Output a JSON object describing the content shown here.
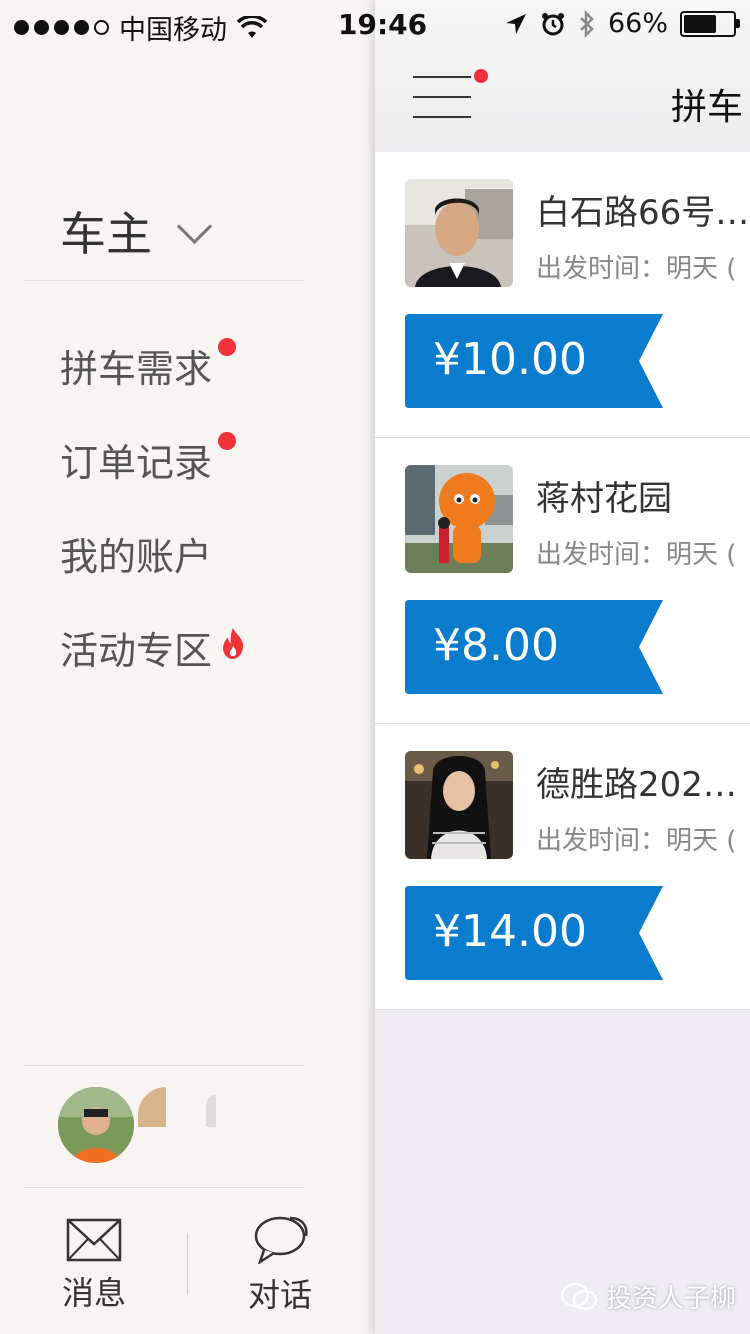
{
  "status_bar": {
    "carrier": "中国移动",
    "time": "19:46",
    "battery_pct": "66%",
    "battery_level": 0.66,
    "signal_bars": 4
  },
  "menu": {
    "role": "车主",
    "items": [
      {
        "label": "拼车需求",
        "badge": "red-dot"
      },
      {
        "label": "订单记录",
        "badge": "red-dot"
      },
      {
        "label": "我的账户",
        "badge": ""
      },
      {
        "label": "活动专区",
        "badge": "flame-icon"
      }
    ],
    "bottom": {
      "messages_label": "消息",
      "chat_label": "对话"
    }
  },
  "main": {
    "title": "拼车",
    "rides": [
      {
        "destination": "白石路66号…",
        "departure": "出发时间：明天 (",
        "price": "¥10.00",
        "avatar": "man-in-car"
      },
      {
        "destination": "蒋村花园",
        "departure": "出发时间：明天 (",
        "price": "¥8.00",
        "avatar": "mascot-photo"
      },
      {
        "destination": "德胜路202…",
        "departure": "出发时间：明天 (",
        "price": "¥14.00",
        "avatar": "woman-portrait"
      }
    ]
  },
  "watermark": "投资人子柳",
  "colors": {
    "accent_blue": "#0a7ccd",
    "badge_red": "#f0333a",
    "menu_bg": "#f8f4f2",
    "panel_bg": "#efedf3"
  }
}
